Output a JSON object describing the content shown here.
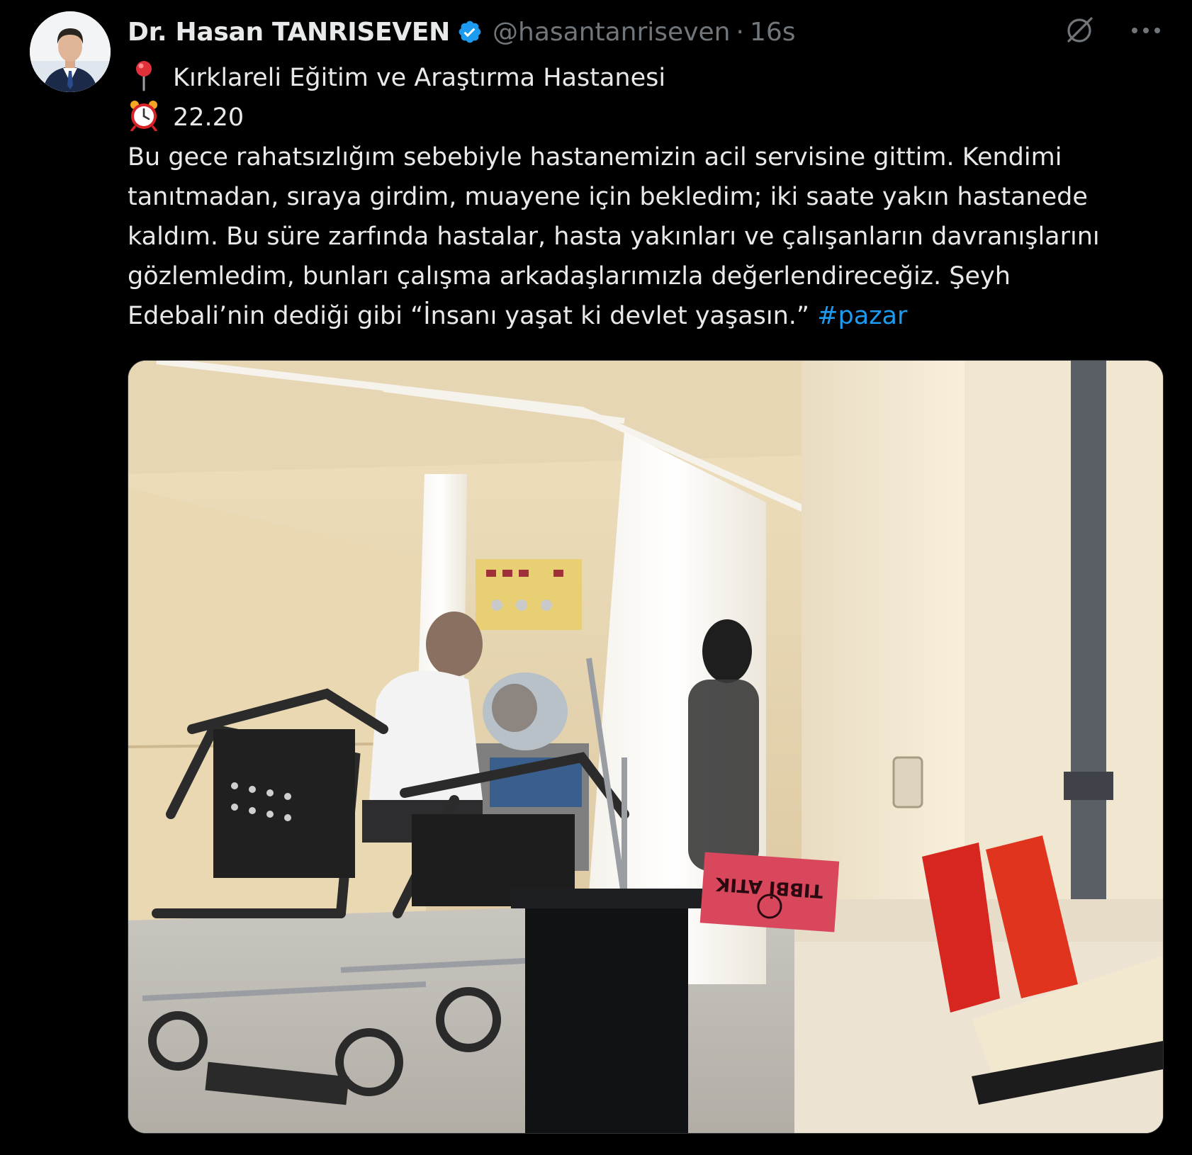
{
  "tweet": {
    "author": {
      "display_name": "Dr. Hasan TANRISEVEN",
      "handle": "@hasantanriseven",
      "verified": true
    },
    "separator": "·",
    "timestamp": "16s",
    "lines": [
      {
        "emoji": "round-pushpin-icon",
        "text": "Kırklareli Eğitim ve Araştırma Hastanesi"
      },
      {
        "emoji": "alarm-clock-icon",
        "text": "22.20"
      },
      {
        "text": "Bu gece rahatsızlığım sebebiyle hastanemizin acil servisine gittim. Kendimi"
      },
      {
        "text": "tanıtmadan, sıraya girdim, muayene için bekledim; iki saate yakın hastanede"
      },
      {
        "text": "kaldım. Bu süre zarfında hastalar, hasta yakınları ve çalışanların davranışlarını"
      },
      {
        "text": "gözlemledim, bunları çalışma arkadaşlarımızla değerlendireceğiz. Şeyh"
      },
      {
        "text": "Edebali’nin dediği gibi “İnsanı yaşat ki devlet yaşasın.” ",
        "hashtag": "#pazar"
      }
    ],
    "media": {
      "sign_text": "TIBBİ ATIK"
    }
  },
  "icons": {
    "header_actions": [
      "grok-slash-icon",
      "more-icon"
    ]
  },
  "colors": {
    "background": "#000000",
    "text": "#e7e9ea",
    "muted": "#71767b",
    "link": "#1d9bf0",
    "verified": "#1d9bf0"
  }
}
